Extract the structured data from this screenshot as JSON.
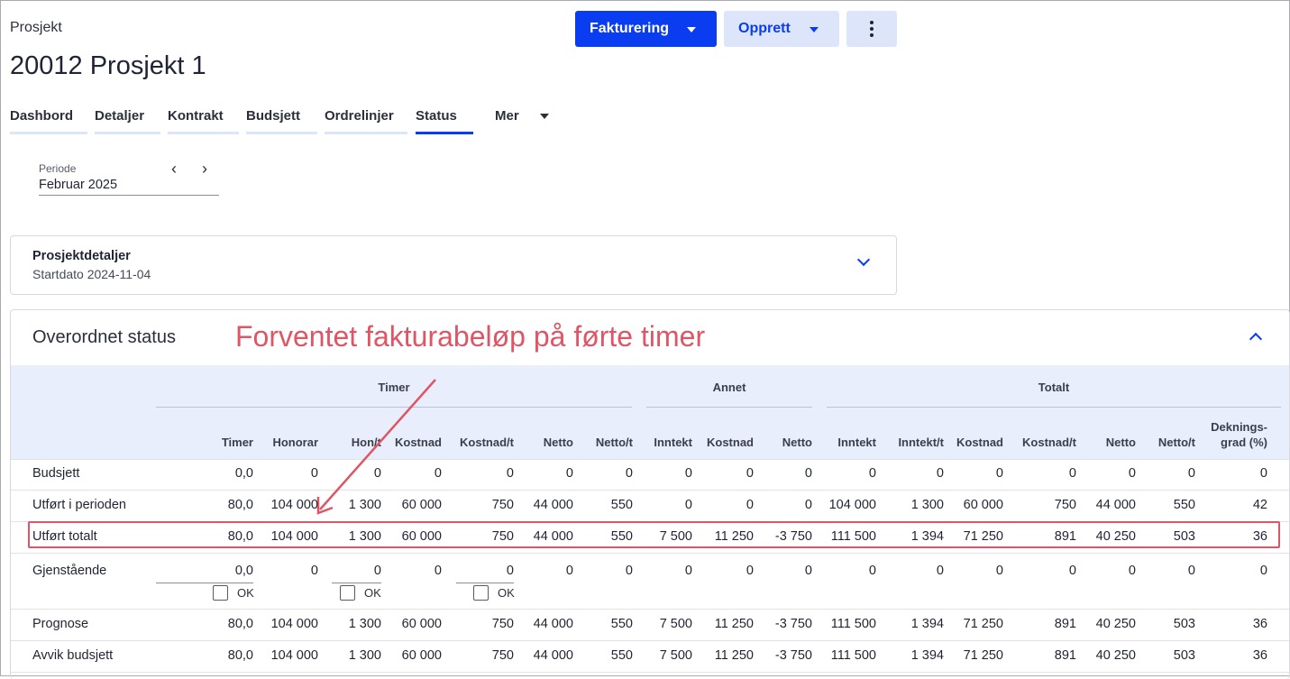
{
  "header": {
    "breadcrumb": "Prosjekt",
    "title": "20012 Prosjekt 1",
    "buttons": {
      "fakturering": "Fakturering",
      "opprett": "Opprett"
    }
  },
  "tabs": [
    "Dashbord",
    "Detaljer",
    "Kontrakt",
    "Budsjett",
    "Ordrelinjer",
    "Status",
    "Mer"
  ],
  "active_tab": "Status",
  "period": {
    "label": "Periode",
    "value": "Februar 2025"
  },
  "project_card": {
    "title": "Prosjektdetaljer",
    "subtitle": "Startdato 2024-11-04"
  },
  "status": {
    "title": "Overordnet status",
    "annotation": "Forventet fakturabeløp på førte timer",
    "groups": [
      "Timer",
      "Annet",
      "Totalt"
    ],
    "columns": [
      "Timer",
      "Honorar",
      "Hon/t",
      "Kostnad",
      "Kostnad/t",
      "Netto",
      "Netto/t",
      "Inntekt",
      "Kostnad",
      "Netto",
      "Inntekt",
      "Inntekt/t",
      "Kostnad",
      "Kostnad/t",
      "Netto",
      "Netto/t",
      "Deknings-",
      "grad (%)"
    ],
    "ok_label": "OK",
    "rows": [
      {
        "label": "Budsjett",
        "values": [
          "0,0",
          "0",
          "0",
          "0",
          "0",
          "0",
          "0",
          "0",
          "0",
          "0",
          "0",
          "0",
          "0",
          "0",
          "0",
          "0",
          "0"
        ]
      },
      {
        "label": "Utført i perioden",
        "values": [
          "80,0",
          "104 000",
          "1 300",
          "60 000",
          "750",
          "44 000",
          "550",
          "0",
          "0",
          "0",
          "104 000",
          "1 300",
          "60 000",
          "750",
          "44 000",
          "550",
          "42"
        ]
      },
      {
        "label": "Utført totalt",
        "values": [
          "80,0",
          "104 000",
          "1 300",
          "60 000",
          "750",
          "44 000",
          "550",
          "7 500",
          "11 250",
          "-3 750",
          "111 500",
          "1 394",
          "71 250",
          "891",
          "40 250",
          "503",
          "36"
        ]
      },
      {
        "label": "Gjenstående",
        "values": [
          "0,0",
          "0",
          "0",
          "0",
          "0",
          "0",
          "0",
          "0",
          "0",
          "0",
          "0",
          "0",
          "0",
          "0",
          "0",
          "0",
          "0"
        ]
      },
      {
        "label": "Prognose",
        "values": [
          "80,0",
          "104 000",
          "1 300",
          "60 000",
          "750",
          "44 000",
          "550",
          "7 500",
          "11 250",
          "-3 750",
          "111 500",
          "1 394",
          "71 250",
          "891",
          "40 250",
          "503",
          "36"
        ]
      },
      {
        "label": "Avvik budsjett",
        "values": [
          "80,0",
          "104 000",
          "1 300",
          "60 000",
          "750",
          "44 000",
          "550",
          "7 500",
          "11 250",
          "-3 750",
          "111 500",
          "1 394",
          "71 250",
          "891",
          "40 250",
          "503",
          "36"
        ]
      }
    ]
  },
  "colors": {
    "primary": "#0a3cf0",
    "secondary_bg": "#dde5fb",
    "annotation": "#e05565",
    "table_header_bg": "#e8eefc"
  }
}
